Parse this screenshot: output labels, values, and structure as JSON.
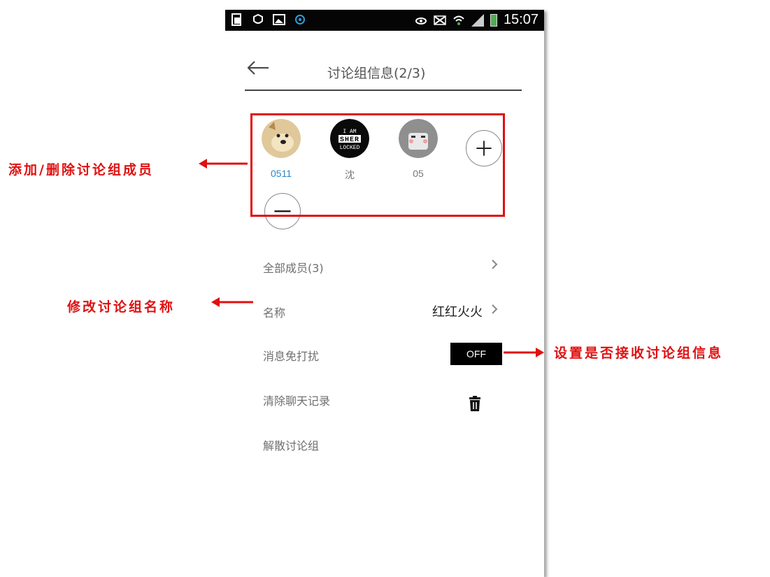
{
  "status_bar": {
    "time": "15:07",
    "left_icons": [
      "document-icon",
      "shield-icon",
      "image-icon",
      "sync-icon"
    ],
    "right_icons": [
      "eye-icon",
      "mute-icon",
      "wifi-icon",
      "signal-icon",
      "battery-icon"
    ]
  },
  "header": {
    "title": "讨论组信息(2/3)"
  },
  "members": [
    {
      "name": "0511",
      "highlight": true,
      "avatar": "dog-avatar"
    },
    {
      "name": "沈",
      "highlight": false,
      "avatar": "sherlocked-avatar",
      "avatar_text_lines": [
        "I AM",
        "SHER",
        "LOCKED"
      ]
    },
    {
      "name": "05",
      "highlight": false,
      "avatar": "cartoon-avatar"
    }
  ],
  "member_actions": {
    "add": "plus-icon",
    "remove": "minus-icon"
  },
  "menu": {
    "all_members": "全部成员(3)",
    "name_label": "名称",
    "name_value": "红红火火",
    "dnd_label": "消息免打扰",
    "dnd_toggle": "OFF",
    "clear_label": "清除聊天记录",
    "dissolve_label": "解散讨论组"
  },
  "annotations": {
    "members": "添加/删除讨论组成员",
    "rename": "修改讨论组名称",
    "dnd": "设置是否接收讨论组信息"
  },
  "colors": {
    "accent_red": "#e01010",
    "member_blue": "#2e86c9",
    "status_bar": "#050505"
  }
}
